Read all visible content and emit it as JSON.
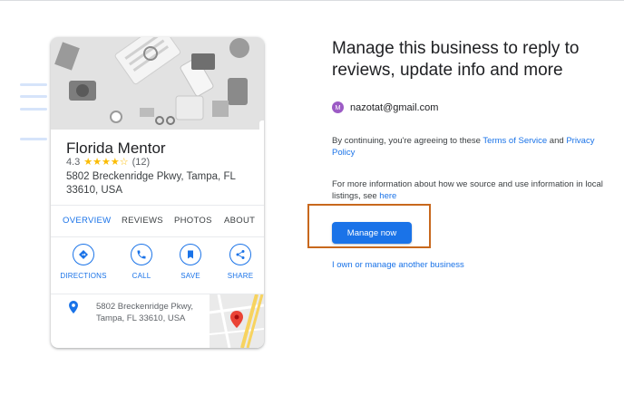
{
  "business": {
    "name": "Florida Mentor",
    "rating": "4.3",
    "stars": "★★★★☆",
    "review_count": "(12)",
    "address": "5802 Breckenridge Pkwy, Tampa, FL 33610, USA",
    "map_address": "5802 Breckenridge Pkwy, Tampa, FL 33610, USA"
  },
  "tabs": [
    "OVERVIEW",
    "REVIEWS",
    "PHOTOS",
    "ABOUT"
  ],
  "actions": [
    {
      "label": "DIRECTIONS",
      "icon": "directions-icon"
    },
    {
      "label": "CALL",
      "icon": "phone-icon"
    },
    {
      "label": "SAVE",
      "icon": "bookmark-icon"
    },
    {
      "label": "SHARE",
      "icon": "share-icon"
    }
  ],
  "panel": {
    "heading": "Manage this business to reply to reviews, update info and more",
    "avatar_letter": "M",
    "email": "nazotat@gmail.com",
    "consent_prefix": "By continuing, you're agreeing to these ",
    "terms_link": "Terms of Service",
    "consent_and": " and ",
    "privacy_link": "Privacy Policy",
    "source_text": "For more information about how we source and use information in local listings, see ",
    "here_link": "here",
    "manage_button": "Manage now",
    "other_business_link": "I own or manage another business"
  },
  "colors": {
    "accent": "#1a73e8",
    "star": "#fbbc04",
    "highlight_border": "#c8681d",
    "avatar": "#9c5bc5",
    "map_pin": "#ea4335"
  }
}
